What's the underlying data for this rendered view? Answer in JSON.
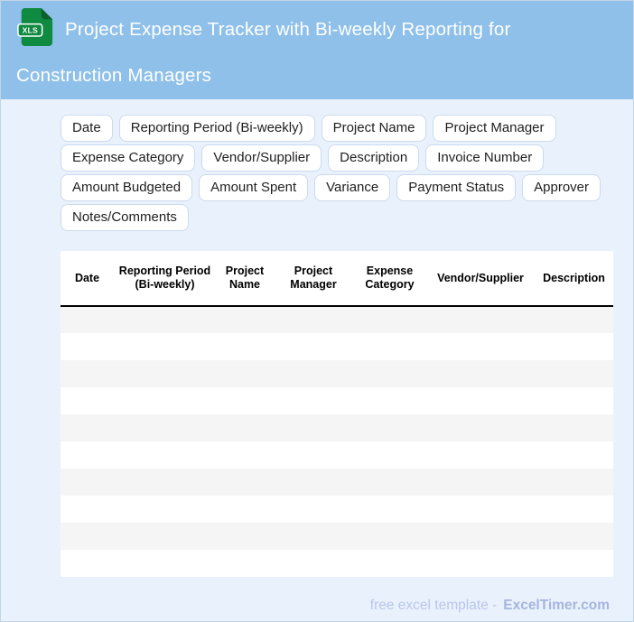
{
  "header": {
    "title": "Project Expense Tracker with Bi-weekly Reporting for Construction Managers",
    "icon_label": "XLS",
    "background_color": "#8fc0e9"
  },
  "chips": [
    "Date",
    "Reporting Period (Bi-weekly)",
    "Project Name",
    "Project Manager",
    "Expense Category",
    "Vendor/Supplier",
    "Description",
    "Invoice Number",
    "Amount Budgeted",
    "Amount Spent",
    "Variance",
    "Payment Status",
    "Approver",
    "Notes/Comments"
  ],
  "table": {
    "columns": [
      "Date",
      "Reporting Period (Bi-weekly)",
      "Project Name",
      "Project Manager",
      "Expense Category",
      "Vendor/Supplier",
      "Description"
    ],
    "empty_row_count": 10,
    "stripe_color": "#f5f5f5"
  },
  "footer": {
    "prefix": "free excel template -",
    "brand": "ExcelTimer.com"
  },
  "colors": {
    "page_background": "#e9f2fc",
    "header_background": "#8fc0e9",
    "icon_green": "#0f8a41",
    "footer_prefix": "#b9c5ec",
    "footer_brand": "#a6b4e0"
  }
}
